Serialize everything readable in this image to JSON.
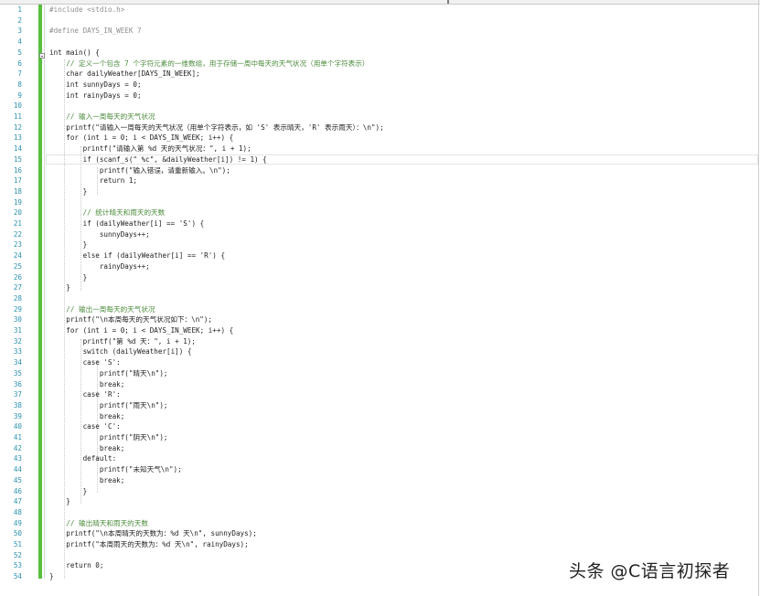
{
  "editor": {
    "lines": [
      {
        "n": "1",
        "t": "#include <stdio.h>",
        "c": "#8e8e8e"
      },
      {
        "n": "2",
        "t": "",
        "c": "#1e1e1e"
      },
      {
        "n": "3",
        "t": "#define DAYS_IN_WEEK 7",
        "c": "#8e8e8e"
      },
      {
        "n": "4",
        "t": "",
        "c": "#1e1e1e"
      },
      {
        "n": "5",
        "t": "int main() {",
        "c": "#1e1e1e"
      },
      {
        "n": "6",
        "t": "    // 定义一个包含 7 个字符元素的一维数组，用于存储一周中每天的天气状况（用单个字符表示）",
        "c": "#4b8b3b"
      },
      {
        "n": "7",
        "t": "    char dailyWeather[DAYS_IN_WEEK];",
        "c": "#1e1e1e"
      },
      {
        "n": "8",
        "t": "    int sunnyDays = 0;",
        "c": "#1e1e1e"
      },
      {
        "n": "9",
        "t": "    int rainyDays = 0;",
        "c": "#1e1e1e"
      },
      {
        "n": "10",
        "t": "",
        "c": "#1e1e1e"
      },
      {
        "n": "11",
        "t": "    // 输入一周每天的天气状况",
        "c": "#4b8b3b"
      },
      {
        "n": "12",
        "t": "    printf(\"请输入一周每天的天气状况（用单个字符表示，如 'S' 表示晴天，'R' 表示雨天）：\\n\");",
        "c": "#1e1e1e"
      },
      {
        "n": "13",
        "t": "    for (int i = 0; i < DAYS_IN_WEEK; i++) {",
        "c": "#1e1e1e"
      },
      {
        "n": "14",
        "t": "        printf(\"请输入第 %d 天的天气状况：\", i + 1);",
        "c": "#1e1e1e"
      },
      {
        "n": "15",
        "t": "        if (scanf_s(\" %c\", &dailyWeather[i]) != 1) {",
        "c": "#1e1e1e"
      },
      {
        "n": "16",
        "t": "            printf(\"输入错误，请重新输入。\\n\");",
        "c": "#1e1e1e"
      },
      {
        "n": "17",
        "t": "            return 1;",
        "c": "#1e1e1e"
      },
      {
        "n": "18",
        "t": "        }",
        "c": "#1e1e1e"
      },
      {
        "n": "19",
        "t": "",
        "c": "#1e1e1e"
      },
      {
        "n": "20",
        "t": "        // 统计晴天和雨天的天数",
        "c": "#4b8b3b"
      },
      {
        "n": "21",
        "t": "        if (dailyWeather[i] == 'S') {",
        "c": "#1e1e1e"
      },
      {
        "n": "22",
        "t": "            sunnyDays++;",
        "c": "#1e1e1e"
      },
      {
        "n": "23",
        "t": "        }",
        "c": "#1e1e1e"
      },
      {
        "n": "24",
        "t": "        else if (dailyWeather[i] == 'R') {",
        "c": "#1e1e1e"
      },
      {
        "n": "25",
        "t": "            rainyDays++;",
        "c": "#1e1e1e"
      },
      {
        "n": "26",
        "t": "        }",
        "c": "#1e1e1e"
      },
      {
        "n": "27",
        "t": "    }",
        "c": "#1e1e1e"
      },
      {
        "n": "28",
        "t": "",
        "c": "#1e1e1e"
      },
      {
        "n": "29",
        "t": "    // 输出一周每天的天气状况",
        "c": "#4b8b3b"
      },
      {
        "n": "30",
        "t": "    printf(\"\\n本周每天的天气状况如下：\\n\");",
        "c": "#1e1e1e"
      },
      {
        "n": "31",
        "t": "    for (int i = 0; i < DAYS_IN_WEEK; i++) {",
        "c": "#1e1e1e"
      },
      {
        "n": "32",
        "t": "        printf(\"第 %d 天：\", i + 1);",
        "c": "#1e1e1e"
      },
      {
        "n": "33",
        "t": "        switch (dailyWeather[i]) {",
        "c": "#1e1e1e"
      },
      {
        "n": "34",
        "t": "        case 'S':",
        "c": "#1e1e1e"
      },
      {
        "n": "35",
        "t": "            printf(\"晴天\\n\");",
        "c": "#1e1e1e"
      },
      {
        "n": "36",
        "t": "            break;",
        "c": "#1e1e1e"
      },
      {
        "n": "37",
        "t": "        case 'R':",
        "c": "#1e1e1e"
      },
      {
        "n": "38",
        "t": "            printf(\"雨天\\n\");",
        "c": "#1e1e1e"
      },
      {
        "n": "39",
        "t": "            break;",
        "c": "#1e1e1e"
      },
      {
        "n": "40",
        "t": "        case 'C':",
        "c": "#1e1e1e"
      },
      {
        "n": "41",
        "t": "            printf(\"阴天\\n\");",
        "c": "#1e1e1e"
      },
      {
        "n": "42",
        "t": "            break;",
        "c": "#1e1e1e"
      },
      {
        "n": "43",
        "t": "        default:",
        "c": "#1e1e1e"
      },
      {
        "n": "44",
        "t": "            printf(\"未知天气\\n\");",
        "c": "#1e1e1e"
      },
      {
        "n": "45",
        "t": "            break;",
        "c": "#1e1e1e"
      },
      {
        "n": "46",
        "t": "        }",
        "c": "#1e1e1e"
      },
      {
        "n": "47",
        "t": "    }",
        "c": "#1e1e1e"
      },
      {
        "n": "48",
        "t": "",
        "c": "#1e1e1e"
      },
      {
        "n": "49",
        "t": "    // 输出晴天和雨天的天数",
        "c": "#4b8b3b"
      },
      {
        "n": "50",
        "t": "    printf(\"\\n本周晴天的天数为：%d 天\\n\", sunnyDays);",
        "c": "#1e1e1e"
      },
      {
        "n": "51",
        "t": "    printf(\"本周雨天的天数为：%d 天\\n\", rainyDays);",
        "c": "#1e1e1e"
      },
      {
        "n": "52",
        "t": "",
        "c": "#1e1e1e"
      },
      {
        "n": "53",
        "t": "    return 0;",
        "c": "#1e1e1e"
      },
      {
        "n": "54",
        "t": "}",
        "c": "#1e1e1e"
      }
    ],
    "colors": {
      "line_number": "#2b91af",
      "comment": "#4b8b3b",
      "preprocessor": "#8e8e8e",
      "text": "#1e1e1e",
      "change_bar": "#57c040"
    }
  },
  "watermark": {
    "text": "头条 @C语言初探者"
  }
}
